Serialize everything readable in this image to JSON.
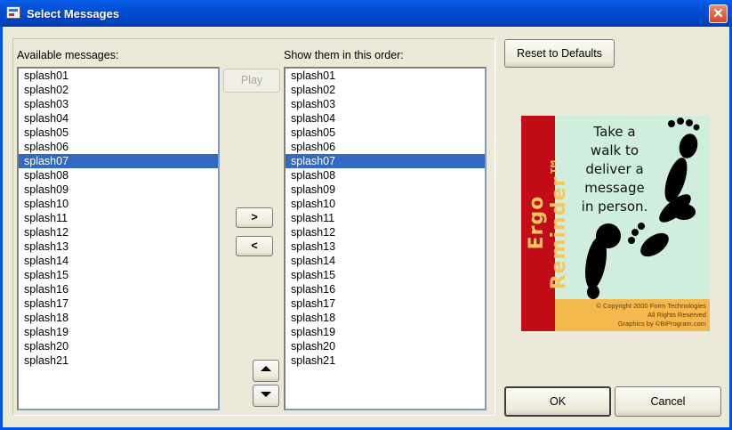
{
  "window": {
    "title": "Select Messages",
    "close_glyph": "✕"
  },
  "available": {
    "label": "Available messages:",
    "items": [
      "splash01",
      "splash02",
      "splash03",
      "splash04",
      "splash05",
      "splash06",
      "splash07",
      "splash08",
      "splash09",
      "splash10",
      "splash11",
      "splash12",
      "splash13",
      "splash14",
      "splash15",
      "splash16",
      "splash17",
      "splash18",
      "splash19",
      "splash20",
      "splash21"
    ],
    "selected_index": 6
  },
  "order": {
    "label": "Show them in this order:",
    "items": [
      "splash01",
      "splash02",
      "splash03",
      "splash04",
      "splash05",
      "splash06",
      "splash07",
      "splash08",
      "splash09",
      "splash10",
      "splash11",
      "splash12",
      "splash13",
      "splash14",
      "splash15",
      "splash16",
      "splash17",
      "splash18",
      "splash19",
      "splash20",
      "splash21"
    ],
    "selected_index": 6
  },
  "buttons": {
    "play": "Play",
    "add": ">",
    "remove": "<",
    "reset": "Reset to Defaults",
    "ok": "OK",
    "cancel": "Cancel"
  },
  "preview": {
    "brand": "Ergo Reminder™",
    "message_lines": [
      "Take a",
      "walk to",
      "deliver a",
      "message",
      "in person."
    ],
    "footer_lines": [
      "© Copyright 2000 Form Technologies",
      "All Rights Reserved",
      "Graphics by ©BiProgram.com"
    ]
  },
  "icons": {
    "up": "move-up-icon",
    "down": "move-down-icon",
    "app": "app-icon",
    "footprints": "footprints-icon"
  },
  "colors": {
    "selection": "#316ac5",
    "title_bar": "#0250d8",
    "splash_red": "#c20d19",
    "splash_bg": "#cfeedd",
    "splash_footer": "#f3b94e"
  }
}
